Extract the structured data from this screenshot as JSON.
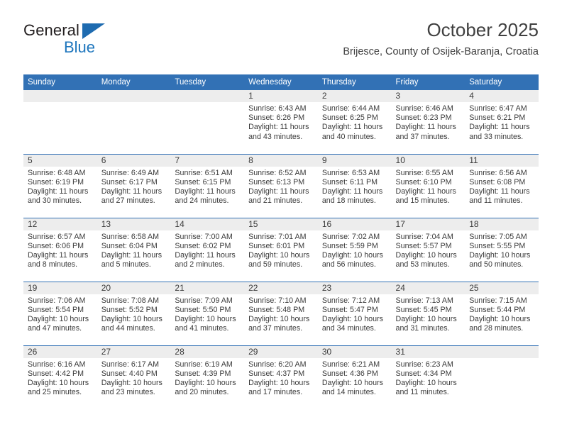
{
  "brand": {
    "name_part1": "General",
    "name_part2": "Blue",
    "triangle_icon": "triangle-icon",
    "accent_color": "#1e76bd"
  },
  "header": {
    "title": "October 2025",
    "subtitle": "Brijesce, County of Osijek-Baranja, Croatia"
  },
  "theme": {
    "header_blue": "#3271b5",
    "daynum_band": "#ededed",
    "text": "#3a3a3a"
  },
  "calendar": {
    "month": "October",
    "year": "2025",
    "weekday_headers": [
      "Sunday",
      "Monday",
      "Tuesday",
      "Wednesday",
      "Thursday",
      "Friday",
      "Saturday"
    ],
    "labels": {
      "sunrise": "Sunrise:",
      "sunset": "Sunset:",
      "daylight": "Daylight:"
    },
    "weeks": [
      [
        {
          "day": "",
          "empty": true
        },
        {
          "day": "",
          "empty": true
        },
        {
          "day": "",
          "empty": true
        },
        {
          "day": "1",
          "sunrise": "Sunrise: 6:43 AM",
          "sunset": "Sunset: 6:26 PM",
          "daylight_line1": "Daylight: 11 hours",
          "daylight_line2": "and 43 minutes."
        },
        {
          "day": "2",
          "sunrise": "Sunrise: 6:44 AM",
          "sunset": "Sunset: 6:25 PM",
          "daylight_line1": "Daylight: 11 hours",
          "daylight_line2": "and 40 minutes."
        },
        {
          "day": "3",
          "sunrise": "Sunrise: 6:46 AM",
          "sunset": "Sunset: 6:23 PM",
          "daylight_line1": "Daylight: 11 hours",
          "daylight_line2": "and 37 minutes."
        },
        {
          "day": "4",
          "sunrise": "Sunrise: 6:47 AM",
          "sunset": "Sunset: 6:21 PM",
          "daylight_line1": "Daylight: 11 hours",
          "daylight_line2": "and 33 minutes."
        }
      ],
      [
        {
          "day": "5",
          "sunrise": "Sunrise: 6:48 AM",
          "sunset": "Sunset: 6:19 PM",
          "daylight_line1": "Daylight: 11 hours",
          "daylight_line2": "and 30 minutes."
        },
        {
          "day": "6",
          "sunrise": "Sunrise: 6:49 AM",
          "sunset": "Sunset: 6:17 PM",
          "daylight_line1": "Daylight: 11 hours",
          "daylight_line2": "and 27 minutes."
        },
        {
          "day": "7",
          "sunrise": "Sunrise: 6:51 AM",
          "sunset": "Sunset: 6:15 PM",
          "daylight_line1": "Daylight: 11 hours",
          "daylight_line2": "and 24 minutes."
        },
        {
          "day": "8",
          "sunrise": "Sunrise: 6:52 AM",
          "sunset": "Sunset: 6:13 PM",
          "daylight_line1": "Daylight: 11 hours",
          "daylight_line2": "and 21 minutes."
        },
        {
          "day": "9",
          "sunrise": "Sunrise: 6:53 AM",
          "sunset": "Sunset: 6:11 PM",
          "daylight_line1": "Daylight: 11 hours",
          "daylight_line2": "and 18 minutes."
        },
        {
          "day": "10",
          "sunrise": "Sunrise: 6:55 AM",
          "sunset": "Sunset: 6:10 PM",
          "daylight_line1": "Daylight: 11 hours",
          "daylight_line2": "and 15 minutes."
        },
        {
          "day": "11",
          "sunrise": "Sunrise: 6:56 AM",
          "sunset": "Sunset: 6:08 PM",
          "daylight_line1": "Daylight: 11 hours",
          "daylight_line2": "and 11 minutes."
        }
      ],
      [
        {
          "day": "12",
          "sunrise": "Sunrise: 6:57 AM",
          "sunset": "Sunset: 6:06 PM",
          "daylight_line1": "Daylight: 11 hours",
          "daylight_line2": "and 8 minutes."
        },
        {
          "day": "13",
          "sunrise": "Sunrise: 6:58 AM",
          "sunset": "Sunset: 6:04 PM",
          "daylight_line1": "Daylight: 11 hours",
          "daylight_line2": "and 5 minutes."
        },
        {
          "day": "14",
          "sunrise": "Sunrise: 7:00 AM",
          "sunset": "Sunset: 6:02 PM",
          "daylight_line1": "Daylight: 11 hours",
          "daylight_line2": "and 2 minutes."
        },
        {
          "day": "15",
          "sunrise": "Sunrise: 7:01 AM",
          "sunset": "Sunset: 6:01 PM",
          "daylight_line1": "Daylight: 10 hours",
          "daylight_line2": "and 59 minutes."
        },
        {
          "day": "16",
          "sunrise": "Sunrise: 7:02 AM",
          "sunset": "Sunset: 5:59 PM",
          "daylight_line1": "Daylight: 10 hours",
          "daylight_line2": "and 56 minutes."
        },
        {
          "day": "17",
          "sunrise": "Sunrise: 7:04 AM",
          "sunset": "Sunset: 5:57 PM",
          "daylight_line1": "Daylight: 10 hours",
          "daylight_line2": "and 53 minutes."
        },
        {
          "day": "18",
          "sunrise": "Sunrise: 7:05 AM",
          "sunset": "Sunset: 5:55 PM",
          "daylight_line1": "Daylight: 10 hours",
          "daylight_line2": "and 50 minutes."
        }
      ],
      [
        {
          "day": "19",
          "sunrise": "Sunrise: 7:06 AM",
          "sunset": "Sunset: 5:54 PM",
          "daylight_line1": "Daylight: 10 hours",
          "daylight_line2": "and 47 minutes."
        },
        {
          "day": "20",
          "sunrise": "Sunrise: 7:08 AM",
          "sunset": "Sunset: 5:52 PM",
          "daylight_line1": "Daylight: 10 hours",
          "daylight_line2": "and 44 minutes."
        },
        {
          "day": "21",
          "sunrise": "Sunrise: 7:09 AM",
          "sunset": "Sunset: 5:50 PM",
          "daylight_line1": "Daylight: 10 hours",
          "daylight_line2": "and 41 minutes."
        },
        {
          "day": "22",
          "sunrise": "Sunrise: 7:10 AM",
          "sunset": "Sunset: 5:48 PM",
          "daylight_line1": "Daylight: 10 hours",
          "daylight_line2": "and 37 minutes."
        },
        {
          "day": "23",
          "sunrise": "Sunrise: 7:12 AM",
          "sunset": "Sunset: 5:47 PM",
          "daylight_line1": "Daylight: 10 hours",
          "daylight_line2": "and 34 minutes."
        },
        {
          "day": "24",
          "sunrise": "Sunrise: 7:13 AM",
          "sunset": "Sunset: 5:45 PM",
          "daylight_line1": "Daylight: 10 hours",
          "daylight_line2": "and 31 minutes."
        },
        {
          "day": "25",
          "sunrise": "Sunrise: 7:15 AM",
          "sunset": "Sunset: 5:44 PM",
          "daylight_line1": "Daylight: 10 hours",
          "daylight_line2": "and 28 minutes."
        }
      ],
      [
        {
          "day": "26",
          "sunrise": "Sunrise: 6:16 AM",
          "sunset": "Sunset: 4:42 PM",
          "daylight_line1": "Daylight: 10 hours",
          "daylight_line2": "and 25 minutes."
        },
        {
          "day": "27",
          "sunrise": "Sunrise: 6:17 AM",
          "sunset": "Sunset: 4:40 PM",
          "daylight_line1": "Daylight: 10 hours",
          "daylight_line2": "and 23 minutes."
        },
        {
          "day": "28",
          "sunrise": "Sunrise: 6:19 AM",
          "sunset": "Sunset: 4:39 PM",
          "daylight_line1": "Daylight: 10 hours",
          "daylight_line2": "and 20 minutes."
        },
        {
          "day": "29",
          "sunrise": "Sunrise: 6:20 AM",
          "sunset": "Sunset: 4:37 PM",
          "daylight_line1": "Daylight: 10 hours",
          "daylight_line2": "and 17 minutes."
        },
        {
          "day": "30",
          "sunrise": "Sunrise: 6:21 AM",
          "sunset": "Sunset: 4:36 PM",
          "daylight_line1": "Daylight: 10 hours",
          "daylight_line2": "and 14 minutes."
        },
        {
          "day": "31",
          "sunrise": "Sunrise: 6:23 AM",
          "sunset": "Sunset: 4:34 PM",
          "daylight_line1": "Daylight: 10 hours",
          "daylight_line2": "and 11 minutes."
        },
        {
          "day": "",
          "empty": true
        }
      ]
    ]
  }
}
